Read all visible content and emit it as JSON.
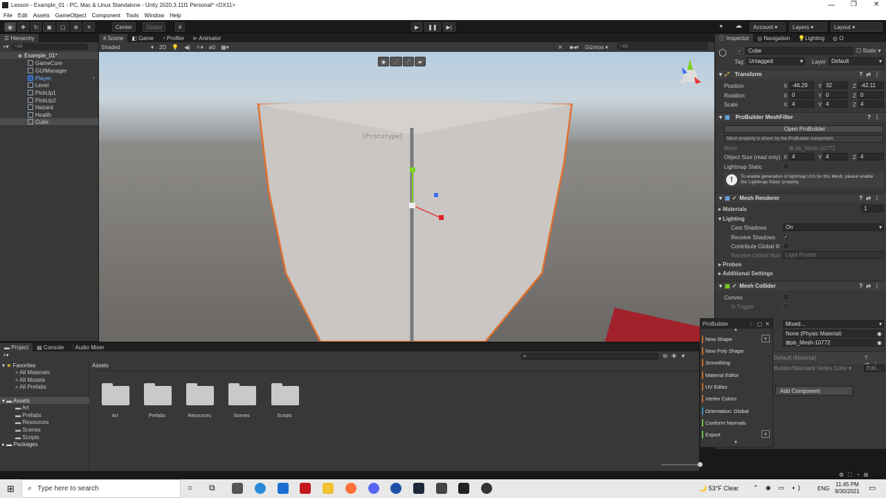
{
  "window": {
    "title": "Lesson - Example_01 - PC, Mac & Linux Standalone - Unity 2020.3.11f1 Personal* <DX11>"
  },
  "menu": [
    "File",
    "Edit",
    "Assets",
    "GameObject",
    "Component",
    "Tools",
    "Window",
    "Help"
  ],
  "toolbar": {
    "center": "Center",
    "global": "Global",
    "account": "Account",
    "layers": "Layers",
    "layout": "Layout"
  },
  "hierarchy": {
    "tab": "Hierarchy",
    "search": "All",
    "scene": "Example_01*",
    "items": [
      "GameCore",
      "GUIManager",
      "Player",
      "Level",
      "PickUp1",
      "PickUp2",
      "Hazard",
      "Health",
      "Cube"
    ]
  },
  "scene": {
    "tabs": [
      "Scene",
      "Game",
      "Profiler",
      "Animator"
    ],
    "shading": "Shaded",
    "mode2d": "2D",
    "fx": "0",
    "gizmos": "Gizmos",
    "search": "All",
    "prototype_label": "[Prototype]"
  },
  "inspector": {
    "tabs": [
      "Inspector",
      "Navigation",
      "Lighting",
      "O"
    ],
    "name": "Cube",
    "static": "Static",
    "tag_label": "Tag",
    "tag": "Untagged",
    "layer_label": "Layer",
    "layer": "Default",
    "transform": {
      "title": "Transform",
      "position_label": "Position",
      "rotation_label": "Rotation",
      "scale_label": "Scale",
      "pos": [
        "-46.29",
        "32",
        "-42.11"
      ],
      "rot": [
        "0",
        "0",
        "0"
      ],
      "scale": [
        "4",
        "4",
        "4"
      ]
    },
    "meshfilter": {
      "title": "ProBuilder MeshFilter",
      "open": "Open ProBuilder",
      "note": "Mesh property is driven by the ProBuilder component.",
      "mesh_label": "Mesh",
      "mesh": "pb_Mesh-10772",
      "size_label": "Object Size (read only)",
      "size": [
        "4",
        "4",
        "4"
      ],
      "lightmap": "Lightmap Static",
      "warn": "To enable generation of lightmap UVs for this Mesh, please enable the 'Lightmap Static' property."
    },
    "renderer": {
      "title": "Mesh Renderer",
      "materials": "Materials",
      "mat_count": "1",
      "lighting": "Lighting",
      "cast": "Cast Shadows",
      "cast_val": "On",
      "receive": "Receive Shadows",
      "contribute": "Contribute Global Ill",
      "receive_gi": "Receive Global Illun",
      "receive_gi_val": "Light Probes",
      "probes": "Probes",
      "additional": "Additional Settings"
    },
    "collider": {
      "title": "Mesh Collider",
      "convex": "Convex",
      "trigger": "Is Trigger",
      "mixed": "Mixed...",
      "material": "None (Physic Material)",
      "mesh": "pb_Mesh-10772"
    },
    "material": {
      "name": "Default (Material)",
      "shader": "Builder/Standard Vertex Color",
      "edit": "Edit..."
    },
    "add_component": "Add Component"
  },
  "probuilder": {
    "title": "ProBuilder",
    "items": [
      {
        "label": "New Shape",
        "color": "#c46a2a"
      },
      {
        "label": "New Poly Shape",
        "color": "#c46a2a"
      },
      {
        "label": "Smoothing",
        "color": "#c46a2a"
      },
      {
        "label": "Material Editor",
        "color": "#c46a2a"
      },
      {
        "label": "UV Editor",
        "color": "#c46a2a"
      },
      {
        "label": "Vertex Colors",
        "color": "#c46a2a"
      },
      {
        "label": "Orientation: Global",
        "color": "#3a8ec4"
      },
      {
        "label": "Conform Normals",
        "color": "#6ab84a"
      },
      {
        "label": "Export",
        "color": "#6ab84a"
      }
    ]
  },
  "project": {
    "tabs": [
      "Project",
      "Console",
      "Audio Mixer"
    ],
    "favorites": "Favorites",
    "fav_items": [
      "All Materials",
      "All Models",
      "All Prefabs"
    ],
    "assets": "Assets",
    "asset_items": [
      "Art",
      "Prefabs",
      "Resources",
      "Scenes",
      "Scripts"
    ],
    "packages": "Packages",
    "breadcrumb": "Assets",
    "folders": [
      "Art",
      "Prefabs",
      "Resources",
      "Scenes",
      "Scripts"
    ]
  },
  "taskbar": {
    "search": "Type here to search",
    "weather": "53°F  Clear",
    "lang": "ENG",
    "time": "11:45 PM",
    "date": "9/30/2021"
  }
}
